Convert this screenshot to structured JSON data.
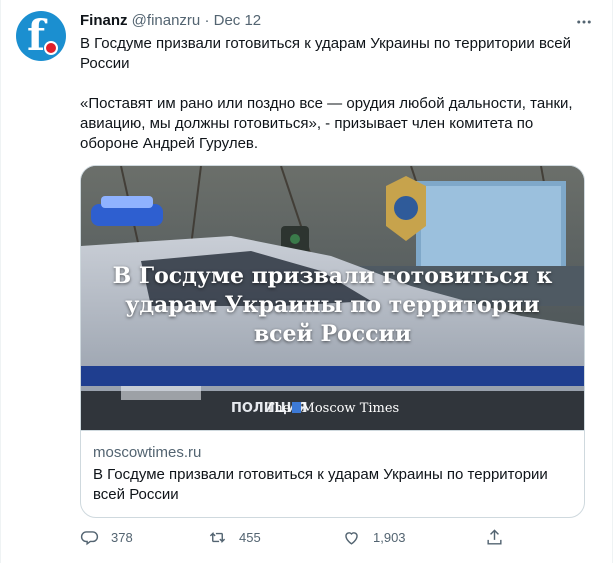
{
  "author": {
    "name": "Finanz",
    "handle": "@finanzru",
    "separator": "·",
    "date": "Dec 12"
  },
  "tweet": {
    "line1": "В Госдуме призвали готовиться к ударам Украины по территории всей России",
    "line2": "«Поставят им рано или поздно все — орудия любой дальности, танки, авиацию, мы должны готовиться», - призывает член комитета по обороне Андрей Гурулев."
  },
  "card": {
    "headline": "В Госдуме призвали готовиться к ударам Украины по территории всей России",
    "logo_prefix": "The",
    "logo_name": "Moscow Times",
    "car_text": "ПОЛИЦИЯ",
    "domain": "moscowtimes.ru",
    "title": "В Госдуме призвали готовиться к ударам Украины по территории всей России"
  },
  "actions": {
    "replies": "378",
    "retweets": "455",
    "likes": "1,903"
  },
  "icons": {
    "more": "more-horizontal-icon",
    "reply": "reply-icon",
    "retweet": "retweet-icon",
    "like": "like-icon",
    "share": "share-icon"
  }
}
